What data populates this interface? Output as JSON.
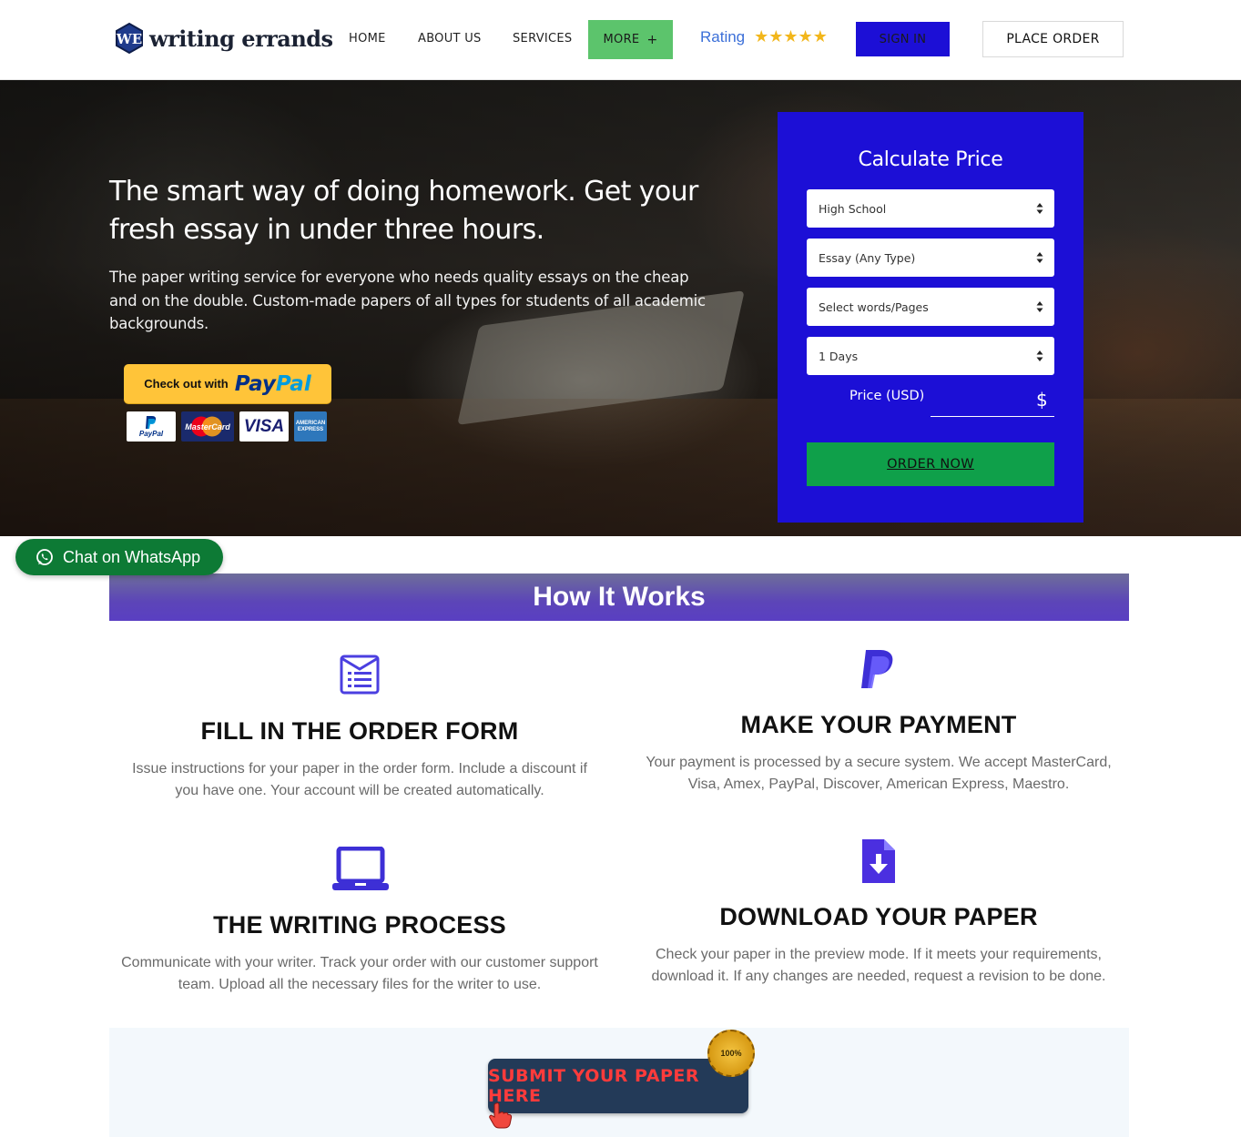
{
  "header": {
    "logo_text": "writing errands",
    "logo_mark": "WE",
    "nav": [
      {
        "label": "HOME"
      },
      {
        "label": "ABOUT US"
      },
      {
        "label": "SERVICES"
      }
    ],
    "more_label": "MORE",
    "more_icon": "plus-icon",
    "rating_label": "Rating",
    "rating_stars": 5,
    "stars_text": "★★★★★",
    "signin_label": "SIGN IN",
    "place_order_label": "PLACE ORDER",
    "colors": {
      "more": "#5cc46c",
      "signin": "#1c0fd6",
      "rating": "#3b6fd8"
    }
  },
  "hero": {
    "title": "The smart way of doing homework. Get your fresh essay in under three hours.",
    "subtitle": "The paper writing service for everyone who needs quality essays on the cheap and on the double. Custom-made papers of all types for students of all academic backgrounds.",
    "paypal": {
      "prefix": "Check out with",
      "pay": "Pay",
      "pal": "Pal"
    },
    "cards": {
      "paypal_label": "PayPal",
      "mastercard_label": "MasterCard",
      "visa_label": "VISA",
      "amex_label": "AMERICAN EXPRESS"
    }
  },
  "calculator": {
    "title": "Calculate Price",
    "level": "High School",
    "type": "Essay (Any Type)",
    "pages": "Select words/Pages",
    "deadline": "1 Days",
    "price_label": "Price (USD)",
    "currency_symbol": "$",
    "order_label": "ORDER NOW",
    "colors": {
      "panel": "#1c0fd6",
      "order": "#0fa04a"
    }
  },
  "whatsapp": {
    "label": "Chat on WhatsApp",
    "icon": "whatsapp-icon"
  },
  "how_it_works": {
    "title": "How It Works",
    "steps": [
      {
        "title": "FILL IN THE ORDER FORM",
        "desc": "Issue instructions for your paper in the order form. Include a discount if you have one. Your account will be created automatically.",
        "icon": "order-form-icon"
      },
      {
        "title": "MAKE YOUR PAYMENT",
        "desc": "Your payment is processed by a secure system. We accept MasterCard, Visa, Amex, PayPal, Discover, American Express, Maestro.",
        "icon": "paypal-icon"
      },
      {
        "title": "THE WRITING PROCESS",
        "desc": "Communicate with your writer. Track your order with our customer support team. Upload all the necessary files for the writer to use.",
        "icon": "laptop-icon"
      },
      {
        "title": "DOWNLOAD YOUR PAPER",
        "desc": "Check your paper in the preview mode. If it meets your requirements, download it. If any changes are needed, request a revision to be done.",
        "icon": "download-file-icon"
      }
    ]
  },
  "submit": {
    "label": "SUBMIT YOUR PAPER HERE",
    "seal_text": "100%",
    "seal_icon": "quality-seal-icon",
    "hand_icon": "pointer-hand-icon"
  }
}
